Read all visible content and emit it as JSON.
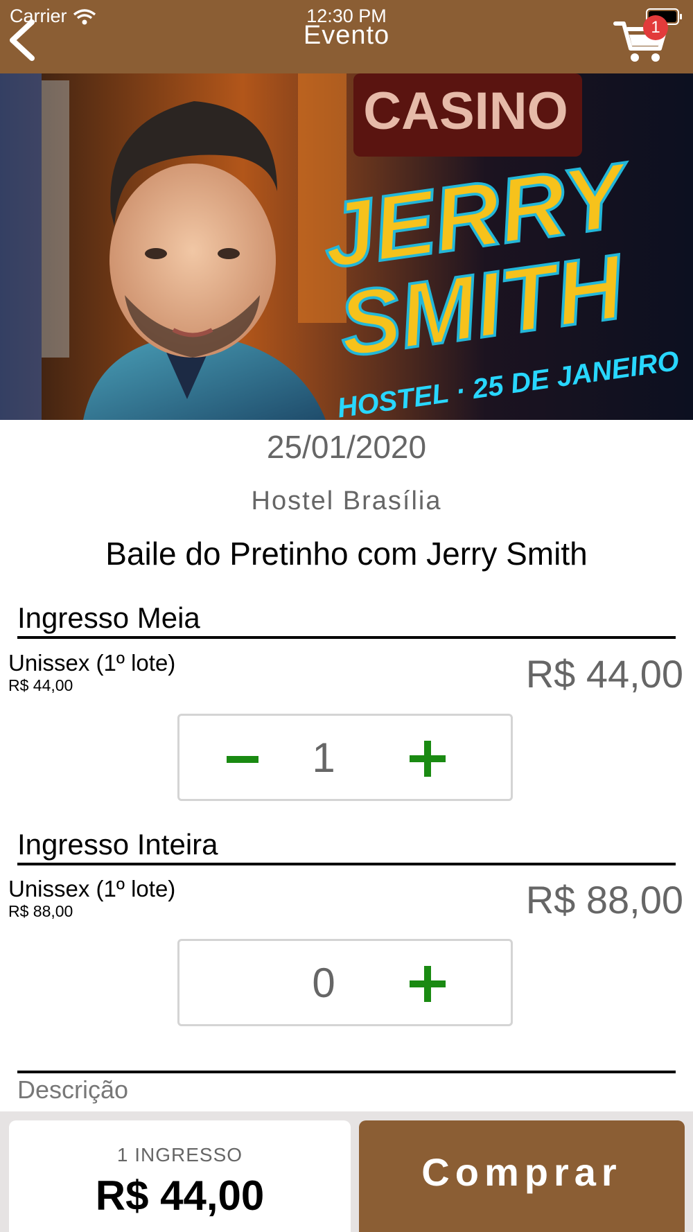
{
  "status_bar": {
    "carrier": "Carrier",
    "time": "12:30 PM"
  },
  "header": {
    "title": "Evento",
    "back_icon": "chevron-left-icon",
    "cart_icon": "cart-icon",
    "cart_count": "1"
  },
  "banner": {
    "artist_line1": "JERRY",
    "artist_line2": "SMITH",
    "subtitle": "HOSTEL · 25 DE JANEIRO",
    "sign_text": "CASINO"
  },
  "event": {
    "date": "25/01/2020",
    "venue": "Hostel Brasília",
    "name": "Baile do Pretinho com Jerry Smith"
  },
  "tickets": [
    {
      "section": "Ingresso Meia",
      "lot": "Unissex (1º lote)",
      "lot_price": "R$ 44,00",
      "price": "R$ 44,00",
      "quantity": "1",
      "minus_visible": true
    },
    {
      "section": "Ingresso Inteira",
      "lot": "Unissex (1º lote)",
      "lot_price": "R$ 88,00",
      "price": "R$ 88,00",
      "quantity": "0",
      "minus_visible": false
    }
  ],
  "description_label": "Descrição",
  "summary": {
    "count_label": "1 INGRESSO",
    "total": "R$ 44,00"
  },
  "buy_button": {
    "label": "Comprar"
  },
  "colors": {
    "brand": "#8B5E34",
    "stepper_green": "#1a8a12",
    "badge_red": "#e23b3b",
    "muted_text": "#666666"
  }
}
